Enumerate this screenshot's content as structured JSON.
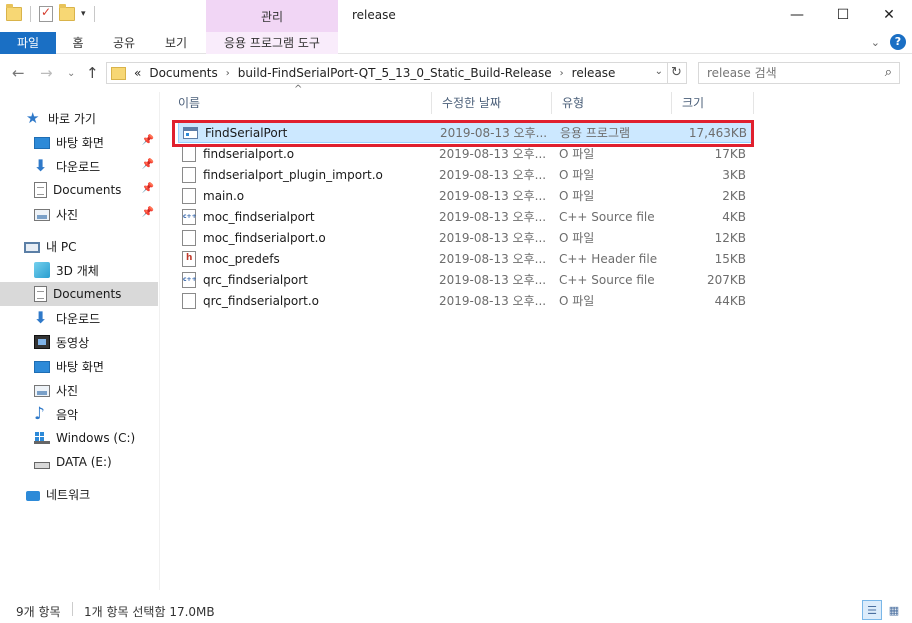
{
  "window": {
    "title": "release",
    "context_tab": "관리",
    "controls": {
      "minimize": "—",
      "maximize": "☐",
      "close": "✕"
    }
  },
  "ribbon": {
    "tabs": [
      "파일",
      "홈",
      "공유",
      "보기",
      "응용 프로그램 도구"
    ],
    "accent": "#1a6fc4",
    "context_color": "#f1d6f5"
  },
  "address": {
    "overflow": "«",
    "breadcrumbs": [
      "Documents",
      "build-FindSerialPort-QT_5_13_0_Static_Build-Release",
      "release"
    ]
  },
  "search": {
    "placeholder": "release 검색"
  },
  "sidebar": {
    "quick_access": {
      "label": "바로 가기",
      "items": [
        {
          "label": "바탕 화면",
          "icon": "desktop-icon"
        },
        {
          "label": "다운로드",
          "icon": "download-icon"
        },
        {
          "label": "Documents",
          "icon": "documents-icon"
        },
        {
          "label": "사진",
          "icon": "pictures-icon"
        }
      ]
    },
    "this_pc": {
      "label": "내 PC",
      "items": [
        {
          "label": "3D 개체",
          "icon": "3d-objects-icon"
        },
        {
          "label": "Documents",
          "icon": "documents-icon",
          "selected": true
        },
        {
          "label": "다운로드",
          "icon": "download-icon"
        },
        {
          "label": "동영상",
          "icon": "videos-icon"
        },
        {
          "label": "바탕 화면",
          "icon": "desktop-icon"
        },
        {
          "label": "사진",
          "icon": "pictures-icon"
        },
        {
          "label": "음악",
          "icon": "music-icon"
        },
        {
          "label": "Windows (C:)",
          "icon": "windows-drive-icon"
        },
        {
          "label": "DATA (E:)",
          "icon": "drive-icon"
        }
      ]
    },
    "network": {
      "label": "네트워크",
      "icon": "network-icon"
    }
  },
  "columns": {
    "name": "이름",
    "date": "수정한 날짜",
    "type": "유형",
    "size": "크기"
  },
  "files": [
    {
      "name": "FindSerialPort",
      "date": "2019-08-13 오후...",
      "type": "응용 프로그램",
      "size": "17,463KB",
      "icon": "exe",
      "selected": true
    },
    {
      "name": "findserialport.o",
      "date": "2019-08-13 오후...",
      "type": "O 파일",
      "size": "17KB",
      "icon": "file"
    },
    {
      "name": "findserialport_plugin_import.o",
      "date": "2019-08-13 오후...",
      "type": "O 파일",
      "size": "3KB",
      "icon": "file"
    },
    {
      "name": "main.o",
      "date": "2019-08-13 오후...",
      "type": "O 파일",
      "size": "2KB",
      "icon": "file"
    },
    {
      "name": "moc_findserialport",
      "date": "2019-08-13 오후...",
      "type": "C++ Source file",
      "size": "4KB",
      "icon": "cpp"
    },
    {
      "name": "moc_findserialport.o",
      "date": "2019-08-13 오후...",
      "type": "O 파일",
      "size": "12KB",
      "icon": "file"
    },
    {
      "name": "moc_predefs",
      "date": "2019-08-13 오후...",
      "type": "C++ Header file",
      "size": "15KB",
      "icon": "hdr"
    },
    {
      "name": "qrc_findserialport",
      "date": "2019-08-13 오후...",
      "type": "C++ Source file",
      "size": "207KB",
      "icon": "cpp"
    },
    {
      "name": "qrc_findserialport.o",
      "date": "2019-08-13 오후...",
      "type": "O 파일",
      "size": "44KB",
      "icon": "file"
    }
  ],
  "status": {
    "count": "9개 항목",
    "selection": "1개 항목 선택함 17.0MB"
  },
  "highlight_color": "#e0202e"
}
